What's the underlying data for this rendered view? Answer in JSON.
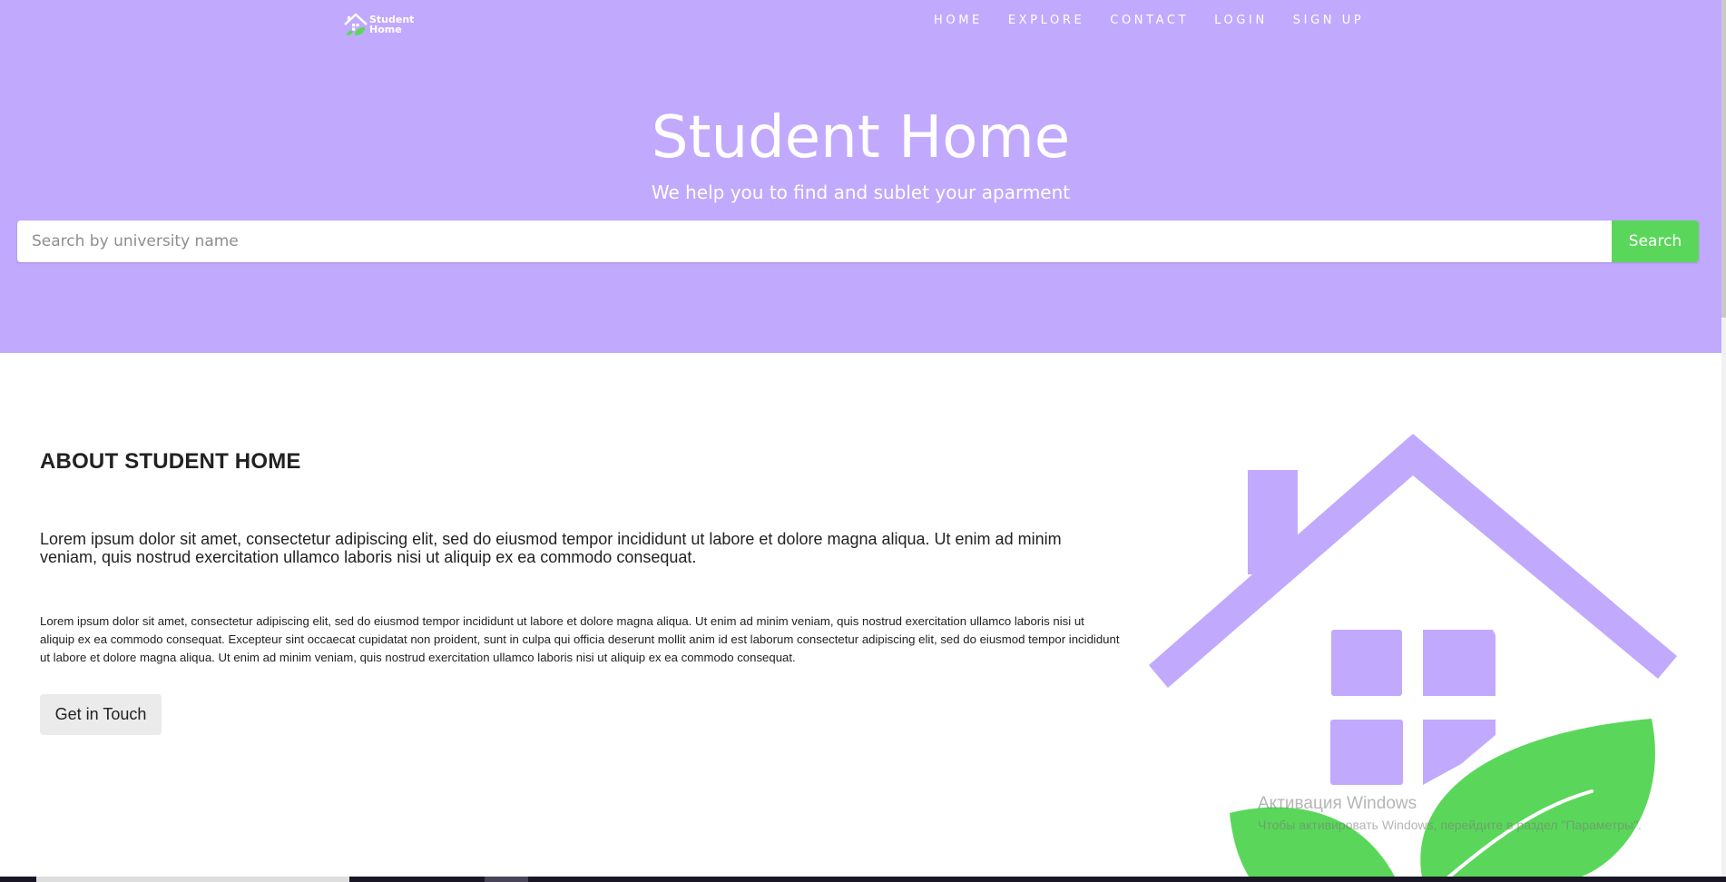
{
  "header": {
    "logo_text_line1": "Student",
    "logo_text_line2": "Home",
    "nav": [
      "HOME",
      "EXPLORE",
      "CONTACT",
      "LOGIN",
      "SIGN UP"
    ]
  },
  "hero": {
    "title": "Student Home",
    "subtitle": "We help you to find and sublet your aparment",
    "search_placeholder": "Search by university name",
    "search_value": "",
    "search_button": "Search"
  },
  "about": {
    "heading": "ABOUT STUDENT HOME",
    "lead": "Lorem ipsum dolor sit amet, consectetur adipiscing elit, sed do eiusmod tempor incididunt ut labore et dolore magna aliqua. Ut enim ad minim veniam, quis nostrud exercitation ullamco laboris nisi ut aliquip ex ea commodo consequat.",
    "body": "Lorem ipsum dolor sit amet, consectetur adipiscing elit, sed do eiusmod tempor incididunt ut labore et dolore magna aliqua. Ut enim ad minim veniam, quis nostrud exercitation ullamco laboris nisi ut aliquip ex ea commodo consequat. Excepteur sint occaecat cupidatat non proident, sunt in culpa qui officia deserunt mollit anim id est laborum consectetur adipiscing elit, sed do eiusmod tempor incididunt ut labore et dolore magna aliqua. Ut enim ad minim veniam, quis nostrud exercitation ullamco laboris nisi ut aliquip ex ea commodo consequat.",
    "cta": "Get in Touch"
  },
  "watermark": {
    "title": "Активация Windows",
    "subtitle": "Чтобы активировать Windows, перейдите в раздел \"Параметры\"."
  },
  "colors": {
    "hero_bg": "#c1a9fe",
    "accent_green": "#5ad75a",
    "illustration_purple": "#c1a9fe",
    "illustration_green": "#5ad75a"
  },
  "icons": {
    "logo": "house-leaf-icon",
    "illustration": "house-with-leaf-illustration"
  }
}
